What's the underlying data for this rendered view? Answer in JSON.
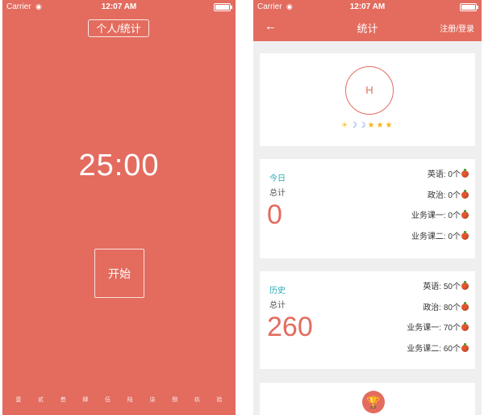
{
  "status": {
    "carrier": "Carrier",
    "wifi_icon": "wifi-icon",
    "time": "12:07 AM"
  },
  "home": {
    "stats_button": "个人/统计",
    "timer": "25:00",
    "start_button": "开始",
    "tabs": [
      "壹",
      "贰",
      "叁",
      "肆",
      "伍",
      "陆",
      "柒",
      "捌",
      "玖",
      "拾"
    ]
  },
  "stats": {
    "nav": {
      "back": "←",
      "title": "统计",
      "login": "注册/登录"
    },
    "avatar": "H",
    "badges": [
      "sun-icon",
      "moon-icon",
      "moon-icon",
      "star-icon",
      "star-icon",
      "star-icon"
    ],
    "today": {
      "title": "今日",
      "label": "总计",
      "total": "0",
      "rows": [
        "英语: 0个",
        "政治: 0个",
        "业务课一: 0个",
        "业务课二: 0个"
      ]
    },
    "history": {
      "title": "历史",
      "label": "总计",
      "total": "260",
      "rows": [
        "英语: 50个",
        "政治: 80个",
        "业务课一: 70个",
        "业务课二: 60个"
      ]
    },
    "trophy_icon": "trophy-icon"
  },
  "colors": {
    "accent": "#e36c5f",
    "teal": "#2aa7b6",
    "background": "#efefef"
  }
}
